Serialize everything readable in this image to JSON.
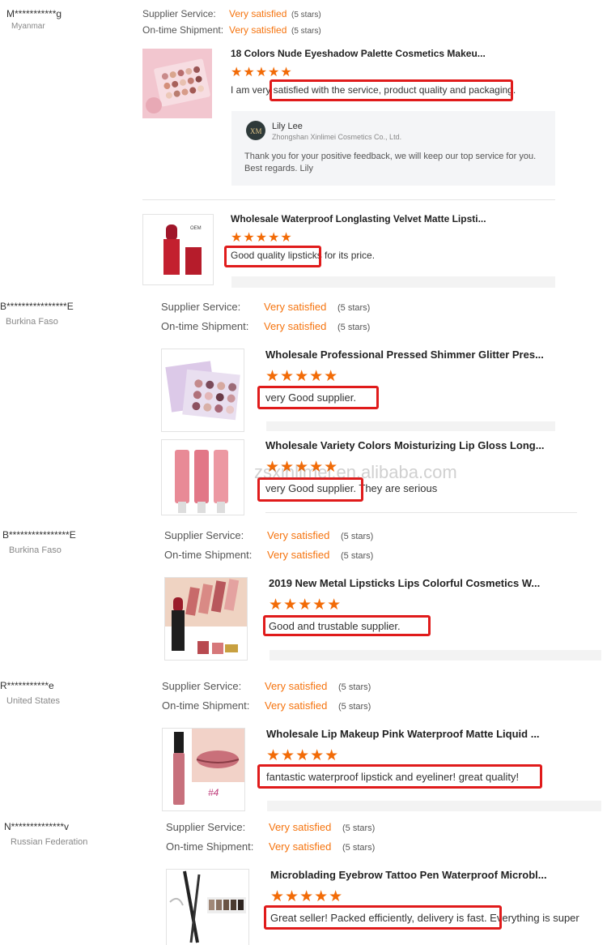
{
  "watermark": "zsxinlimei.en.alibaba.com",
  "labels": {
    "supplier_service": "Supplier Service:",
    "on_time_shipment": "On-time Shipment:",
    "very_satisfied": "Very satisfied",
    "five_stars": "(5 stars)",
    "stars_glyphs": "★★★★★"
  },
  "reviews": [
    {
      "buyer": "M***********g",
      "country": "Myanmar",
      "products": [
        {
          "title": "18 Colors Nude Eyeshadow Palette Cosmetics Makeu...",
          "rating": 5,
          "comment": "I am very satisfied with the service, product quality and packaging.",
          "reply": {
            "name": "Lily Lee",
            "company": "Zhongshan Xinlimei Cosmetics Co., Ltd.",
            "text1": "Thank you for your positive feedback, we will keep our top service for you.",
            "text2": "Best regards. Lily"
          }
        },
        {
          "title": "Wholesale Waterproof Longlasting Velvet Matte Lipsti...",
          "rating": 5,
          "comment": "Good quality lipsticks for its price."
        }
      ]
    },
    {
      "buyer": "B****************E",
      "country": "Burkina Faso",
      "products": [
        {
          "title": "Wholesale Professional Pressed Shimmer Glitter Pres...",
          "rating": 5,
          "comment": "very Good supplier."
        },
        {
          "title": "Wholesale Variety Colors Moisturizing Lip Gloss Long...",
          "rating": 5,
          "comment": "very Good supplier. They are serious"
        }
      ]
    },
    {
      "buyer": "B****************E",
      "country": "Burkina Faso",
      "products": [
        {
          "title": "2019 New Metal Lipsticks Lips Colorful Cosmetics W...",
          "rating": 5,
          "comment": "Good and trustable supplier."
        }
      ]
    },
    {
      "buyer": "R***********e",
      "country": "United States",
      "products": [
        {
          "title": "Wholesale Lip Makeup Pink Waterproof Matte Liquid ...",
          "rating": 5,
          "comment": "fantastic waterproof lipstick and eyeliner! great quality!",
          "thumb_label": "#4"
        }
      ]
    },
    {
      "buyer": "N**************v",
      "country": "Russian Federation",
      "products": [
        {
          "title": "Microblading Eyebrow Tattoo Pen Waterproof Microbl...",
          "rating": 5,
          "comment": "Great seller! Packed efficiently, delivery is fast. Everything is super"
        }
      ]
    }
  ],
  "colors": {
    "accent": "#f5740f",
    "star": "#f26b07",
    "highlight": "#e01b1b"
  }
}
